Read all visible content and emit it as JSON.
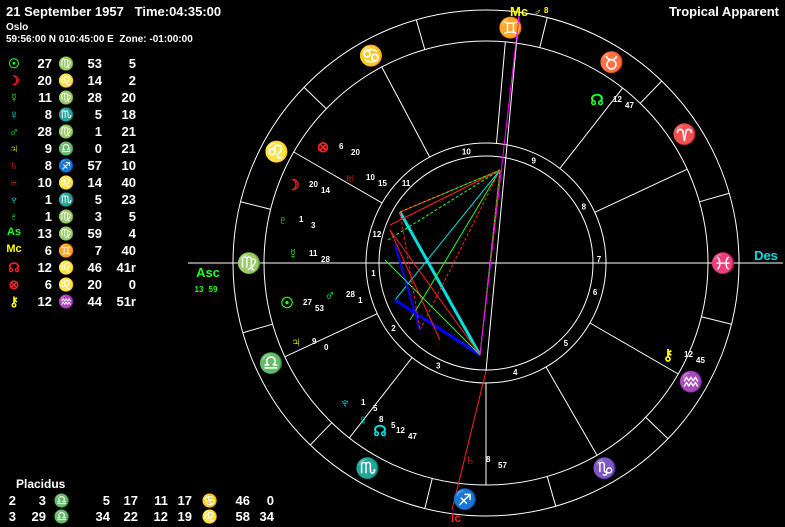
{
  "header": {
    "date_time": "21 September 1957   Time:04:35:00",
    "place": "Oslo",
    "coords": "59:56:00 N 010:45:00 E  Zone: -01:00:00",
    "mode": "Tropical Apparent"
  },
  "colors": {
    "fire": "#ff2020",
    "earth": "#20ff20",
    "air": "#ffff00",
    "water": "#00e0e0",
    "ring": "#ffffff",
    "magenta": "#ff00ff"
  },
  "planets": [
    {
      "glyph": "☉",
      "deg": "27",
      "sign": "♍",
      "min": "53",
      "sec": "5",
      "color": "#20ff20"
    },
    {
      "glyph": "☽",
      "deg": "20",
      "sign": "♌",
      "min": "14",
      "sec": "2",
      "color": "#ff2020"
    },
    {
      "glyph": "☿",
      "deg": "11",
      "sign": "♍",
      "min": "28",
      "sec": "20",
      "color": "#20ff20"
    },
    {
      "glyph": "♀",
      "deg": "8",
      "sign": "♏",
      "min": "5",
      "sec": "18",
      "color": "#00e0e0"
    },
    {
      "glyph": "♂",
      "deg": "28",
      "sign": "♍",
      "min": "1",
      "sec": "21",
      "color": "#20ff20"
    },
    {
      "glyph": "♃",
      "deg": "9",
      "sign": "♎",
      "min": "0",
      "sec": "21",
      "color": "#ffff00"
    },
    {
      "glyph": "♄",
      "deg": "8",
      "sign": "♐",
      "min": "57",
      "sec": "10",
      "color": "#ff2020"
    },
    {
      "glyph": "♅",
      "deg": "10",
      "sign": "♌",
      "min": "14",
      "sec": "40",
      "color": "#ff2020"
    },
    {
      "glyph": "♆",
      "deg": "1",
      "sign": "♏",
      "min": "5",
      "sec": "23",
      "color": "#00e0e0"
    },
    {
      "glyph": "♇",
      "deg": "1",
      "sign": "♍",
      "min": "3",
      "sec": "5",
      "color": "#20ff20"
    },
    {
      "glyph": "As",
      "deg": "13",
      "sign": "♍",
      "min": "59",
      "sec": "4",
      "color": "#20ff20"
    },
    {
      "glyph": "Mc",
      "deg": "6",
      "sign": "♊",
      "min": "7",
      "sec": "40",
      "color": "#ffff00"
    },
    {
      "glyph": "☊",
      "deg": "12",
      "sign": "♌",
      "min": "46",
      "sec": "41r",
      "color": "#ff2020"
    },
    {
      "glyph": "⊗",
      "deg": "6",
      "sign": "♌",
      "min": "20",
      "sec": "0",
      "color": "#ff2020"
    },
    {
      "glyph": "⚷",
      "deg": "12",
      "sign": "♒",
      "min": "44",
      "sec": "51r",
      "color": "#ffff00"
    }
  ],
  "houses": {
    "title": "Placidus",
    "rows": [
      {
        "c1": "2",
        "d1": "3",
        "s1": "♎",
        "m1": "5",
        "c2": "17",
        "d2": "11",
        "m2": "17",
        "s2": "♋",
        "x2": "46",
        "y2": "0",
        "col1": "#ffff00",
        "col2": "#00e0e0"
      },
      {
        "c1": "3",
        "d1": "29",
        "s1": "♎",
        "m1": "34",
        "c2": "22",
        "d2": "12",
        "m2": "19",
        "s2": "♌",
        "x2": "58",
        "y2": "34",
        "col1": "#ffff00",
        "col2": "#ff2020"
      }
    ]
  },
  "chart": {
    "mc_label": "Mc",
    "mc_deg": "6",
    "mc_min": "8",
    "ic_label": "Ic",
    "asc_label": "Asc",
    "asc_deg": "13",
    "asc_min": "59",
    "des_label": "Des",
    "house_numbers": [
      "1",
      "2",
      "3",
      "4",
      "5",
      "6",
      "7",
      "8",
      "9",
      "10",
      "11",
      "12"
    ],
    "sign_glyphs": [
      {
        "name": "gemini",
        "glyph": "♊",
        "color": "#ffff00"
      },
      {
        "name": "taurus",
        "glyph": "♉",
        "color": "#20ff20"
      },
      {
        "name": "aries",
        "glyph": "♈",
        "color": "#ff2020"
      },
      {
        "name": "pisces",
        "glyph": "♓",
        "color": "#00e0e0"
      },
      {
        "name": "aquarius",
        "glyph": "♒",
        "color": "#ffff00"
      },
      {
        "name": "capricorn",
        "glyph": "♑",
        "color": "#20ff20"
      },
      {
        "name": "sagittarius",
        "glyph": "♐",
        "color": "#ff2020"
      },
      {
        "name": "scorpio",
        "glyph": "♏",
        "color": "#00e0e0"
      },
      {
        "name": "libra",
        "glyph": "♎",
        "color": "#ffff00"
      },
      {
        "name": "virgo",
        "glyph": "♍",
        "color": "#20ff20"
      },
      {
        "name": "leo",
        "glyph": "♌",
        "color": "#ff2020"
      },
      {
        "name": "cancer",
        "glyph": "♋",
        "color": "#00e0e0"
      }
    ],
    "wheel_planets": [
      {
        "name": "node-in-taurus",
        "glyph": "☊",
        "d": "12",
        "m": "47",
        "color": "#20ff20"
      },
      {
        "name": "pof",
        "glyph": "⊗",
        "d": "6",
        "m": "20",
        "color": "#ff2020"
      },
      {
        "name": "moon",
        "glyph": "☽",
        "d": "20",
        "m": "14",
        "color": "#ff2020"
      },
      {
        "name": "uranus",
        "glyph": "♅",
        "d": "10",
        "m": "15",
        "color": "#ff2020"
      },
      {
        "name": "pluto",
        "glyph": "♇",
        "d": "1",
        "m": "3",
        "color": "#20ff20"
      },
      {
        "name": "mercury",
        "glyph": "☿",
        "d": "11",
        "m": "28",
        "color": "#20ff20"
      },
      {
        "name": "sun",
        "glyph": "☉",
        "d": "27",
        "m": "53",
        "color": "#20ff20"
      },
      {
        "name": "mars",
        "glyph": "♂",
        "d": "28",
        "m": "1",
        "color": "#20ff20"
      },
      {
        "name": "jupiter",
        "glyph": "♃",
        "d": "9",
        "m": "0",
        "color": "#ffff00"
      },
      {
        "name": "neptune",
        "glyph": "♆",
        "d": "1",
        "m": "5",
        "color": "#00e0e0"
      },
      {
        "name": "venus",
        "glyph": "♀",
        "d": "8",
        "m": "5",
        "color": "#00e0e0"
      },
      {
        "name": "node",
        "glyph": "☊",
        "d": "12",
        "m": "47",
        "color": "#00e0e0"
      },
      {
        "name": "saturn",
        "glyph": "♄",
        "d": "8",
        "m": "57",
        "color": "#ff2020"
      },
      {
        "name": "chiron",
        "glyph": "⚷",
        "d": "12",
        "m": "45",
        "color": "#ffff00"
      }
    ]
  }
}
